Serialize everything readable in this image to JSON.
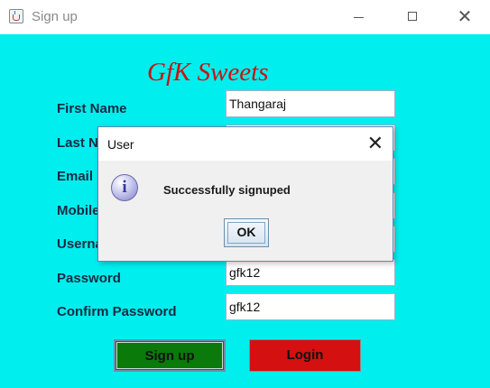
{
  "window": {
    "title": "Sign up"
  },
  "brand": "GfK Sweets",
  "form": {
    "fields": [
      {
        "label": "First Name",
        "value": "Thangaraj"
      },
      {
        "label": "Last Name",
        "value": ""
      },
      {
        "label": "Email",
        "value": ""
      },
      {
        "label": "Mobile",
        "value": ""
      },
      {
        "label": "Username",
        "value": ""
      },
      {
        "label": "Password",
        "value": "gfk12"
      },
      {
        "label": "Confirm Password",
        "value": "gfk12"
      }
    ]
  },
  "buttons": {
    "signup": "Sign up",
    "login": "Login"
  },
  "dialog": {
    "title": "User",
    "message": "Successfully signuped",
    "ok": "OK",
    "icon": "info-icon"
  },
  "colors": {
    "background": "#00eeee",
    "brand": "#cc1111",
    "signup_button": "#0a7a0a",
    "login_button": "#d41010"
  }
}
